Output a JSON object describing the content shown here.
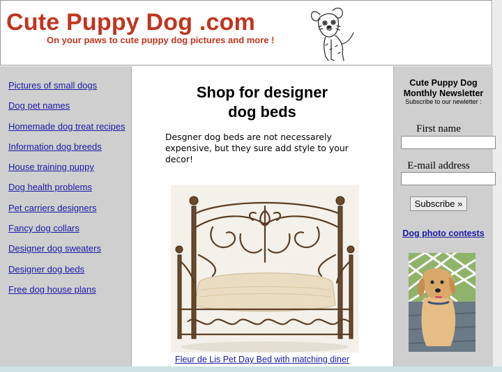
{
  "header": {
    "site_title": "Cute Puppy Dog .com",
    "tagline": "On your paws to cute puppy dog pictures and more !",
    "logo_icon": "sketch-dog-logo"
  },
  "sidebar": {
    "links": [
      {
        "label": "Pictures of small dogs"
      },
      {
        "label": "Dog pet names"
      },
      {
        "label": "Homemade dog treat recipes"
      },
      {
        "label": "Information dog breeds"
      },
      {
        "label": "House training puppy"
      },
      {
        "label": "Dog health problems"
      },
      {
        "label": "Pet carriers designers"
      },
      {
        "label": "Fancy dog collars"
      },
      {
        "label": "Designer dog sweaters"
      },
      {
        "label": "Designer dog beds"
      },
      {
        "label": "Free dog house plans"
      }
    ]
  },
  "main": {
    "title": "Shop for designer dog beds",
    "intro": "Desgner dog beds are not necessarely expensive, but they sure add style to your decor!",
    "product_image": "iron-scroll-dog-bed-photo",
    "product_caption": "Fleur de Lis Pet Day Bed with matching diner"
  },
  "newsletter": {
    "title": "Cute Puppy Dog Monthly Newsletter",
    "subtitle": "Subscribe to our newletter :",
    "first_name_label": "First name",
    "email_label": "E-mail address",
    "subscribe_label": "Subscribe »",
    "contest_link": "Dog photo contests",
    "puppy_image": "golden-retriever-puppy-photo"
  },
  "colors": {
    "title_red": "#c0351f",
    "link_blue": "#1a1aa6",
    "sidebar_gray": "#cfcfcf"
  }
}
